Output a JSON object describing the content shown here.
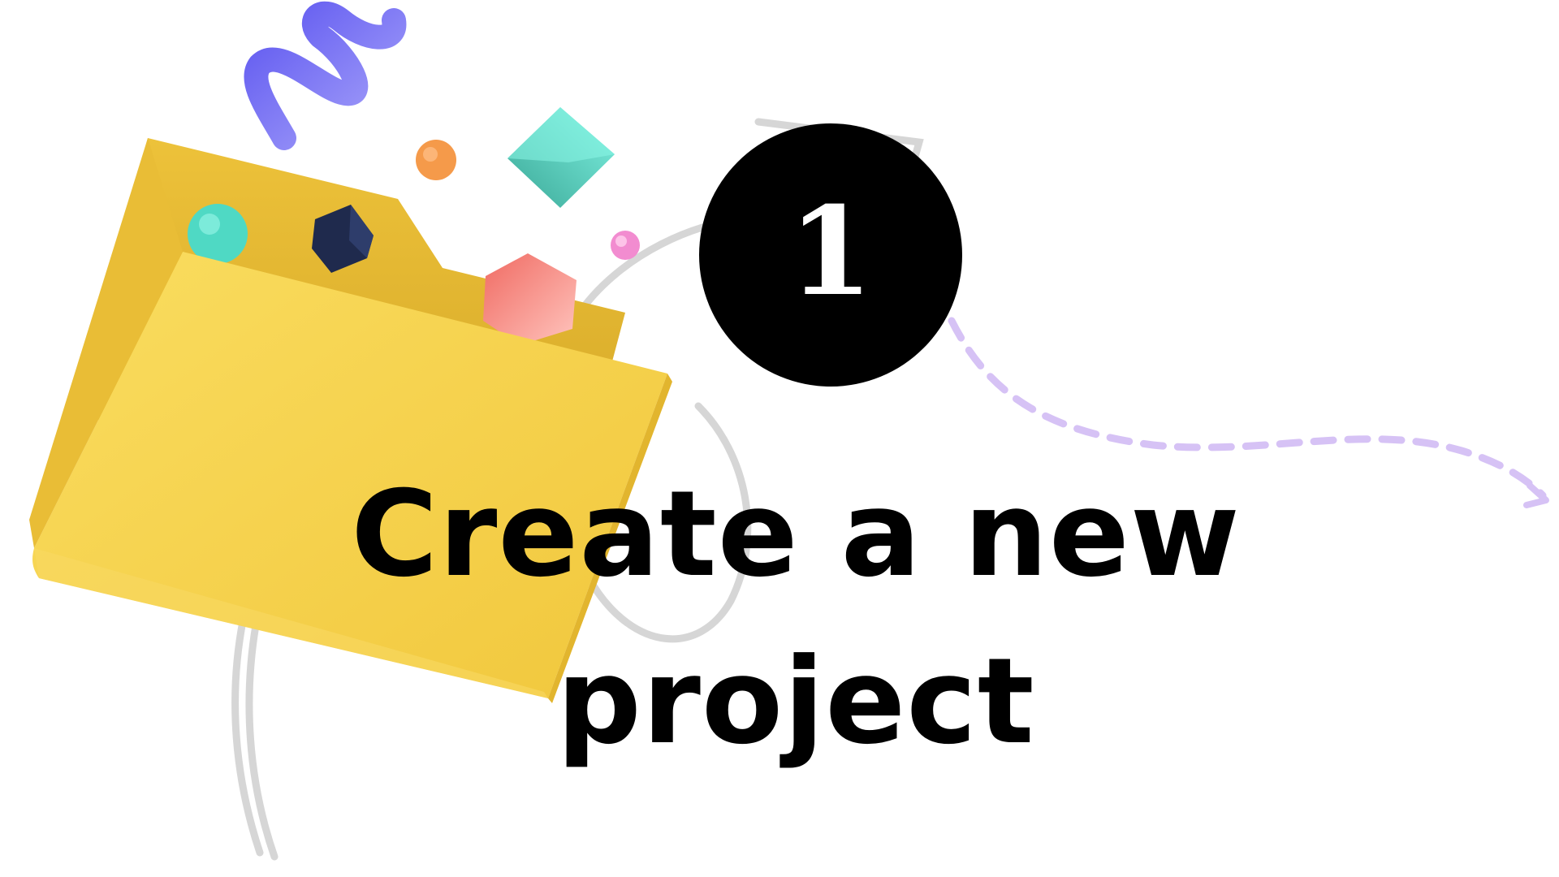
{
  "step": {
    "number": "1"
  },
  "headline": {
    "line1": "Create a new",
    "line2": "project"
  },
  "colors": {
    "folder": "#F6CF45",
    "folder_shadow": "#E0B22E",
    "squiggle": "#6F6BF2",
    "teal_cube": "#4FC9B0",
    "pink_gem": "#F47C7C",
    "navy_cube": "#1F2A4D",
    "orange_dot": "#F59A4A",
    "pink_dot": "#F28CD0",
    "dashed_arrow": "#D6C2F5",
    "swirl_lines": "#D8D8D8",
    "badge": "#000000"
  },
  "icons": [
    "folder-icon",
    "arrow-icon"
  ]
}
